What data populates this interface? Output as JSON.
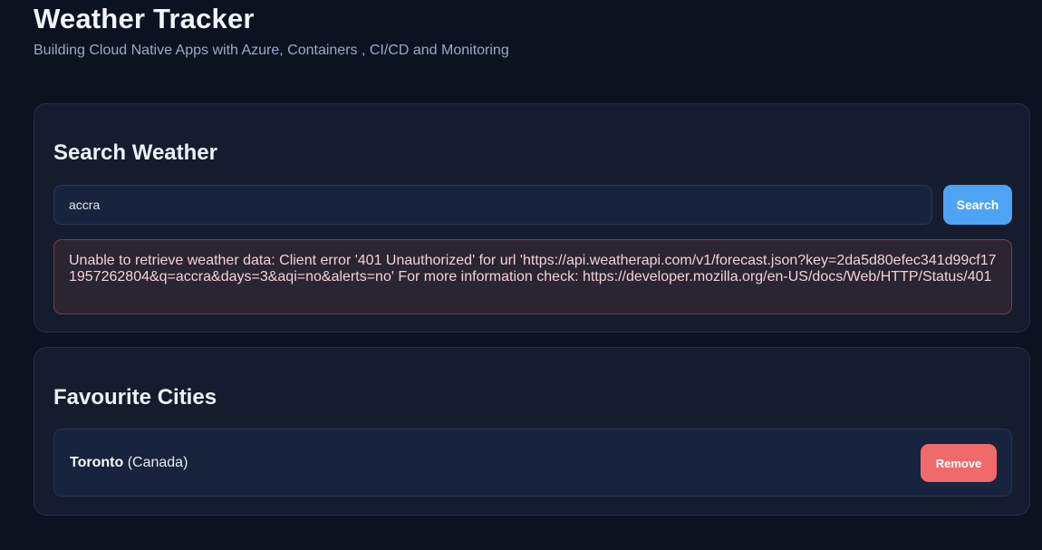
{
  "header": {
    "title": "Weather Tracker",
    "subtitle": "Building Cloud Native Apps with Azure, Containers , CI/CD and Monitoring"
  },
  "search": {
    "title": "Search Weather",
    "input_value": "accra",
    "button_label": "Search",
    "error_message": "Unable to retrieve weather data: Client error '401 Unauthorized' for url 'https://api.weatherapi.com/v1/forecast.json?key=2da5d80efec341d99cf171957262804&q=accra&days=3&aqi=no&alerts=no' For more information check: https://developer.mozilla.org/en-US/docs/Web/HTTP/Status/401"
  },
  "favourites": {
    "title": "Favourite Cities",
    "items": [
      {
        "city": "Toronto",
        "country": "(Canada)",
        "remove_label": "Remove"
      }
    ]
  },
  "colors": {
    "background": "#0b1220",
    "card": "#141c2e",
    "accent": "#4ea3f5",
    "danger": "#f06a6a",
    "error_bg": "#2b2431",
    "error_border": "#7a3d4c"
  }
}
